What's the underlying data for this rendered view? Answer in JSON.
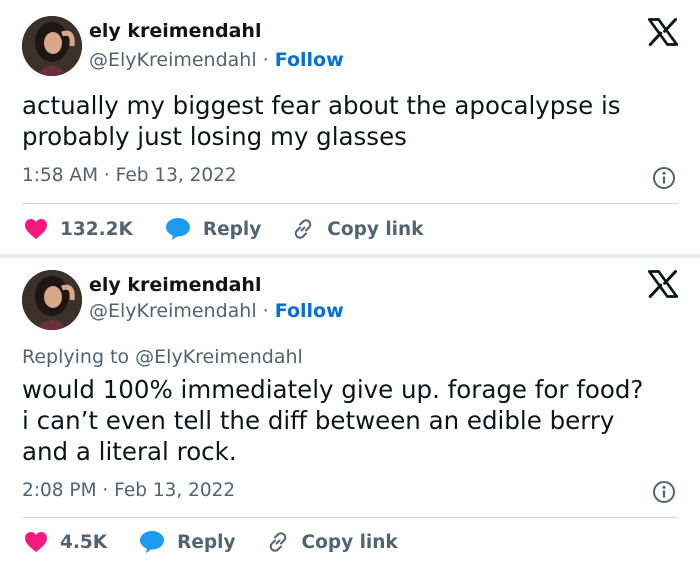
{
  "colors": {
    "accent": "#006fd6",
    "like": "#f91880",
    "reply": "#1d9bf0",
    "muted": "#536471",
    "text": "#0f1419",
    "divider": "#cfd9de"
  },
  "tweets": [
    {
      "author": {
        "name": "ely kreimendahl",
        "handle": "@ElyKreimendahl",
        "separator": "·",
        "follow_label": "Follow",
        "avatar_icon": "avatar-photo"
      },
      "replying_to": null,
      "text": "actually my biggest fear about the apocalypse is\nprobably just losing my glasses",
      "timestamp": "1:58 AM · Feb 13, 2022",
      "likes": "132.2K",
      "reply_label": "Reply",
      "copy_label": "Copy link"
    },
    {
      "author": {
        "name": "ely kreimendahl",
        "handle": "@ElyKreimendahl",
        "separator": "·",
        "follow_label": "Follow",
        "avatar_icon": "avatar-photo"
      },
      "replying_to": {
        "prefix": "Replying to",
        "handle": "@ElyKreimendahl"
      },
      "text": "would 100% immediately give up. forage for food?\ni can’t even tell the diff between an edible berry\nand a literal rock.",
      "timestamp": "2:08 PM · Feb 13, 2022",
      "likes": "4.5K",
      "reply_label": "Reply",
      "copy_label": "Copy link"
    }
  ]
}
